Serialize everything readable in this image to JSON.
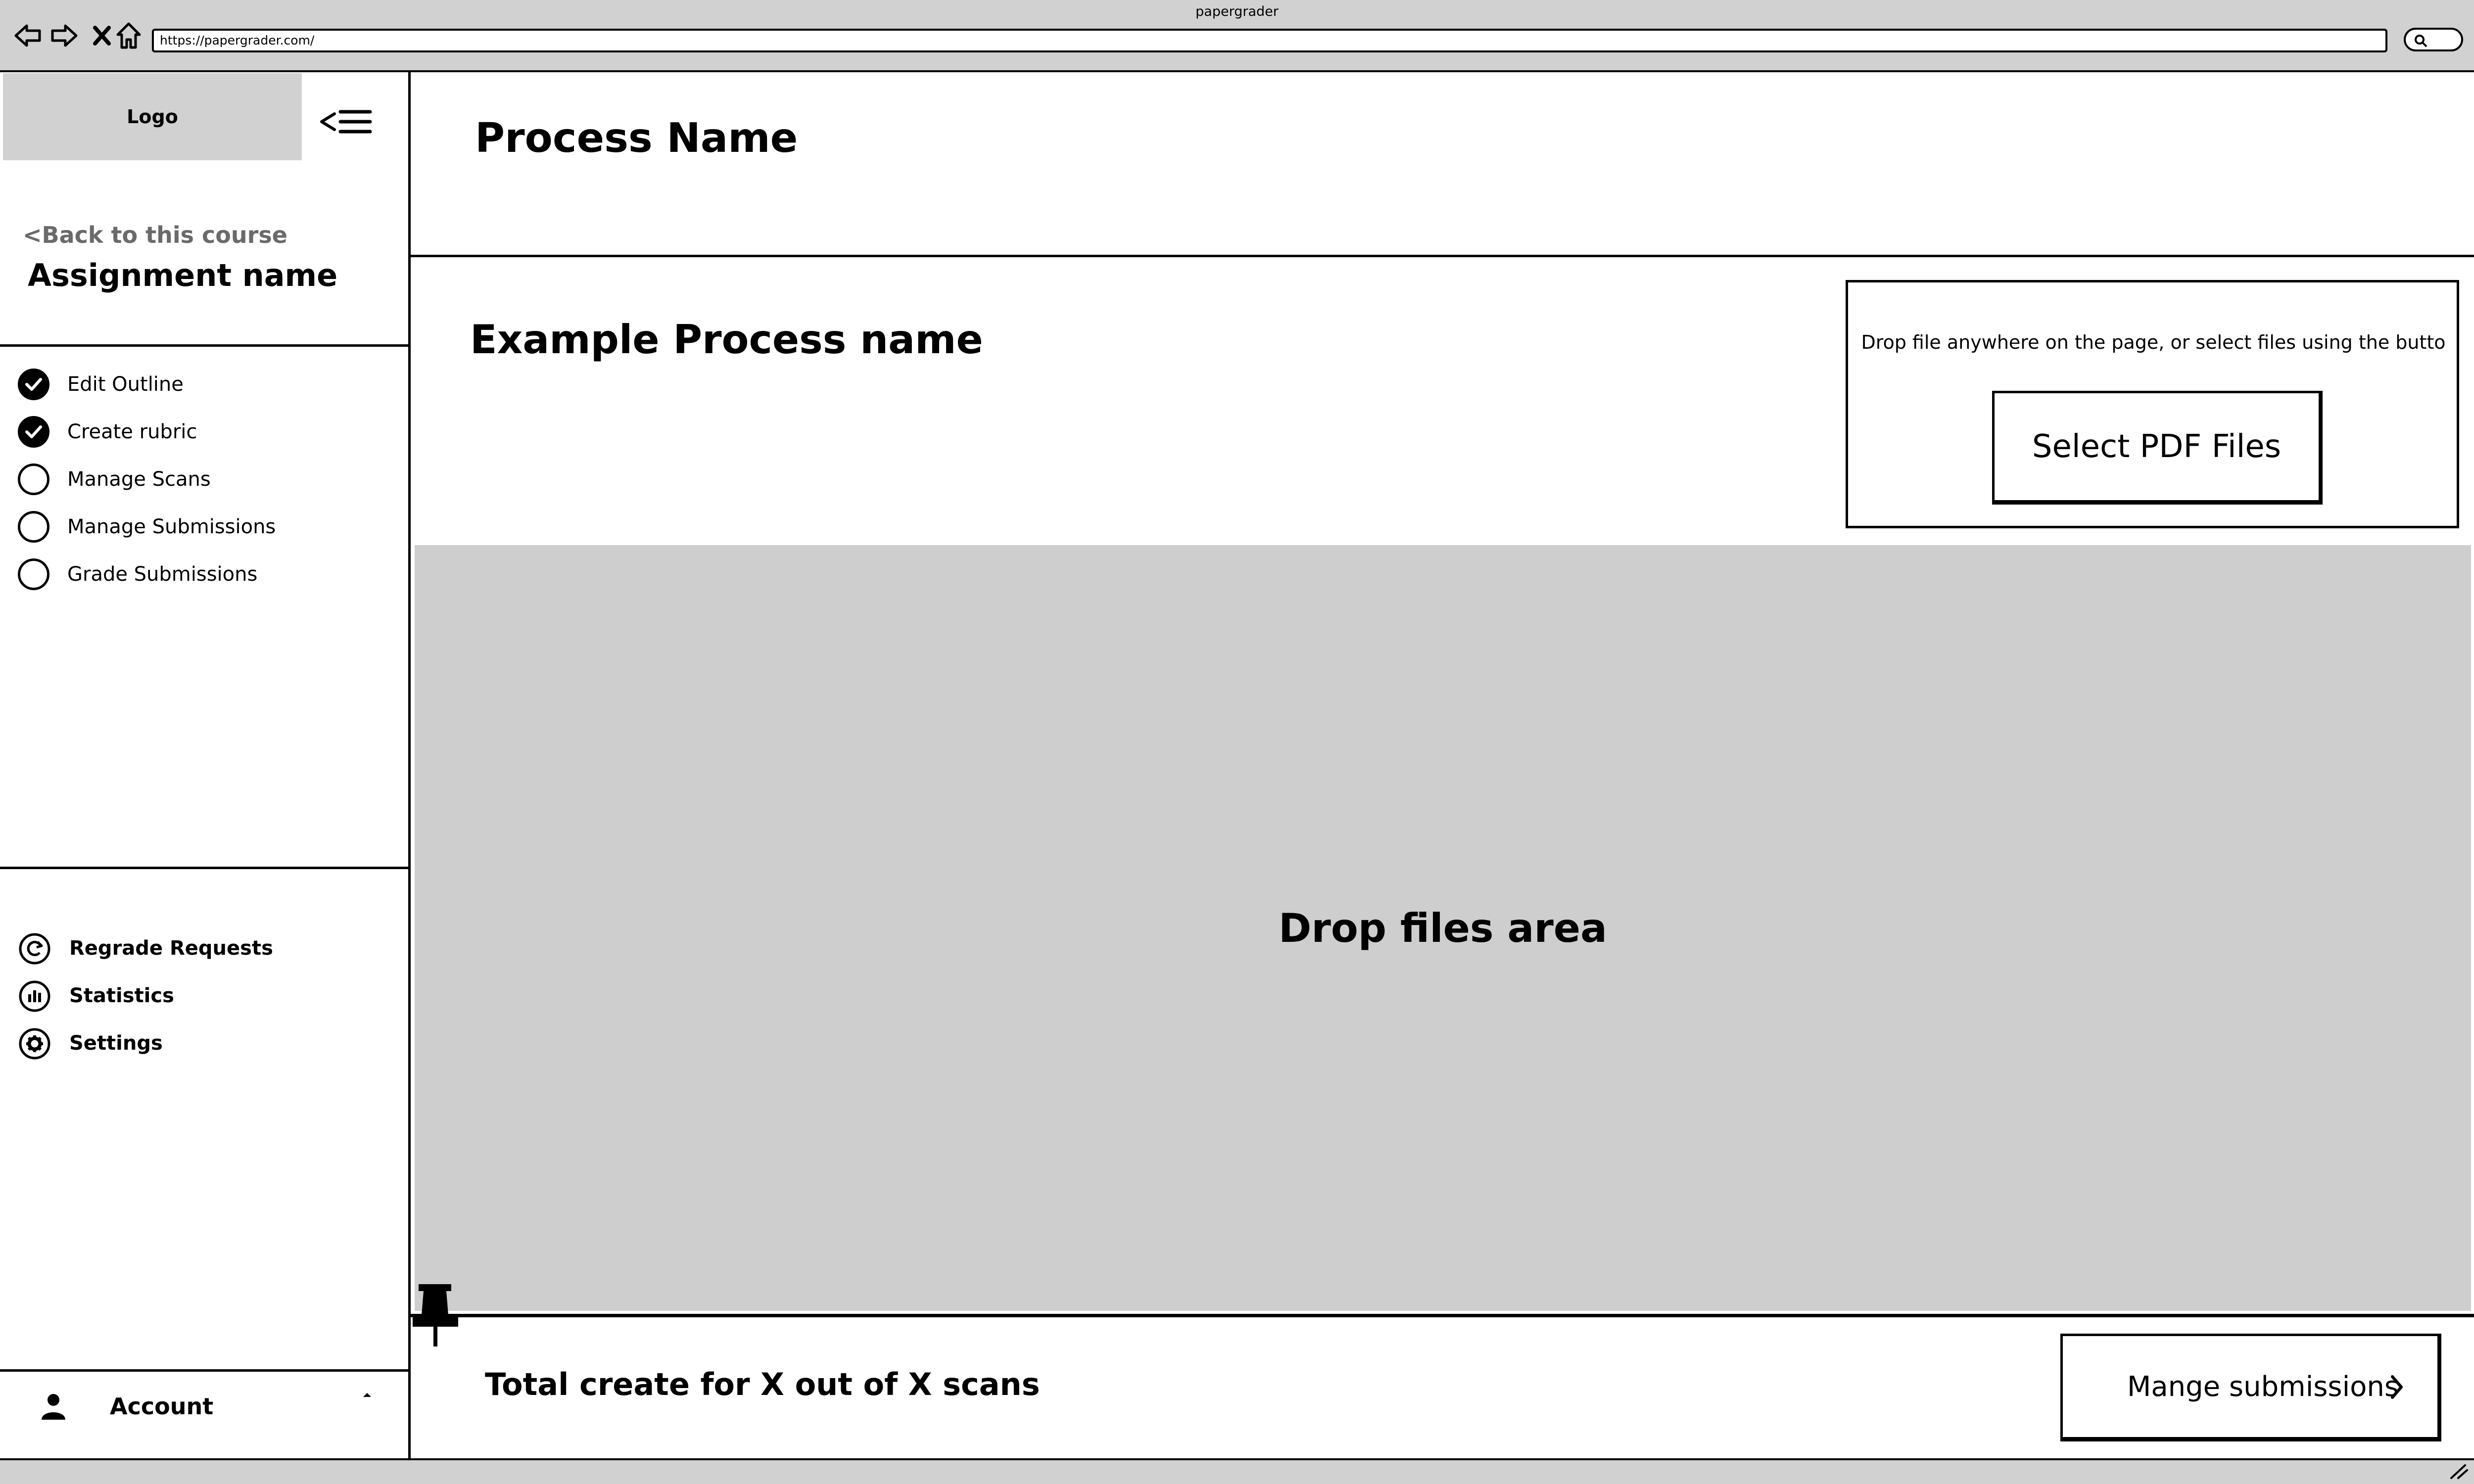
{
  "browser": {
    "title": "papergrader",
    "url": "https://papergrader.com/",
    "icons": [
      "back-arrow-icon",
      "forward-arrow-icon",
      "close-icon",
      "home-icon",
      "search-icon"
    ]
  },
  "sidebar": {
    "logo": "Logo",
    "back_link": "<Back to this course",
    "assignment_name": "Assignment name",
    "steps": [
      {
        "label": "Edit Outline",
        "done": true
      },
      {
        "label": "Create rubric",
        "done": true
      },
      {
        "label": "Manage Scans",
        "done": false
      },
      {
        "label": "Manage Submissions",
        "done": false
      },
      {
        "label": "Grade Submissions",
        "done": false
      }
    ],
    "tools": [
      {
        "label": "Regrade Requests",
        "icon": "refresh-icon"
      },
      {
        "label": "Statistics",
        "icon": "bar-chart-icon"
      },
      {
        "label": "Settings",
        "icon": "gear-icon"
      }
    ],
    "account": {
      "label": "Account",
      "icon": "user-icon",
      "caret": "caret-up-icon"
    }
  },
  "main": {
    "process_name": "Process Name",
    "example_process_name": "Example Process name",
    "upload_hint": "Drop file anywhere on the page, or select files using the butto",
    "select_button": "Select PDF Files",
    "drop_area_label": "Drop files area",
    "total_text": "Total create for X out of X scans",
    "manage_button": "Mange submissions"
  },
  "colors": {
    "chrome_gray": "#d1d1d1",
    "drop_area_gray": "#cecece",
    "back_link_gray": "#6a6a6a"
  }
}
